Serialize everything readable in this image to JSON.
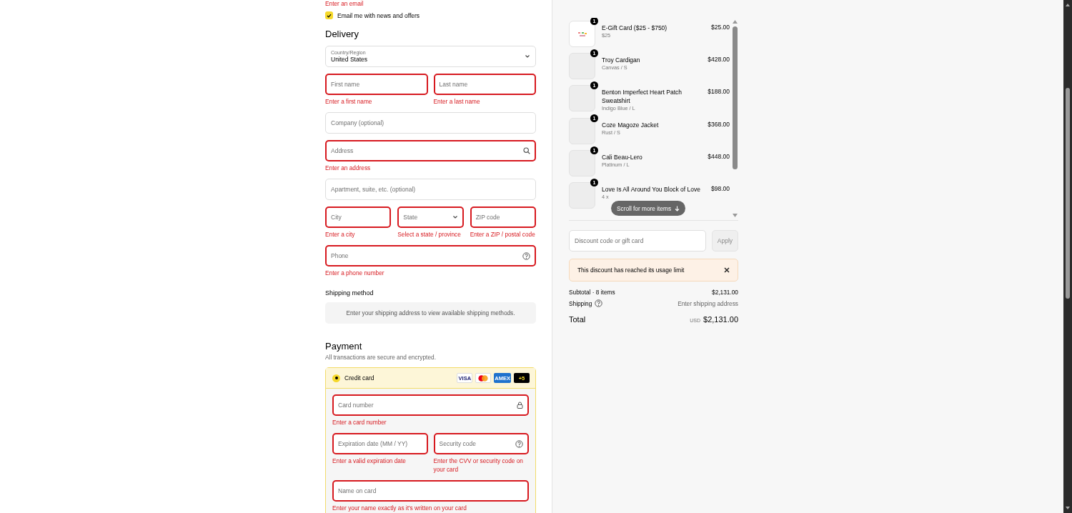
{
  "contact": {
    "email_error": "Enter an email",
    "newsletter": {
      "label": "Email me with news and offers",
      "checked": true
    }
  },
  "delivery": {
    "title": "Delivery",
    "rows": [
      [
        {
          "kind": "select",
          "label": "Country/Region",
          "value": "United States",
          "invalid": false
        }
      ],
      [
        {
          "kind": "text",
          "placeholder": "First name",
          "invalid": true,
          "error": "Enter a first name"
        },
        {
          "kind": "text",
          "placeholder": "Last name",
          "invalid": true,
          "error": "Enter a last name"
        }
      ],
      [
        {
          "kind": "text",
          "placeholder": "Company (optional)",
          "invalid": false
        }
      ],
      [
        {
          "kind": "search",
          "placeholder": "Address",
          "invalid": true,
          "error": "Enter an address"
        }
      ],
      [
        {
          "kind": "text",
          "placeholder": "Apartment, suite, etc. (optional)",
          "invalid": false
        }
      ],
      [
        {
          "kind": "text",
          "placeholder": "City",
          "invalid": true,
          "error": "Enter a city"
        },
        {
          "kind": "select",
          "placeholder": "State",
          "invalid": true,
          "error": "Select a state / province"
        },
        {
          "kind": "text",
          "placeholder": "ZIP code",
          "invalid": true,
          "error": "Enter a ZIP / postal code"
        }
      ],
      [
        {
          "kind": "help",
          "placeholder": "Phone",
          "invalid": true,
          "error": "Enter a phone number"
        }
      ]
    ]
  },
  "shipping_method": {
    "title": "Shipping method",
    "message": "Enter your shipping address to view available shipping methods."
  },
  "payment": {
    "title": "Payment",
    "subtitle": "All transactions are secure and encrypted.",
    "method": {
      "label": "Credit card",
      "selected": true,
      "brands": [
        {
          "kind": "visa",
          "label": "VISA"
        },
        {
          "kind": "mastercard"
        },
        {
          "kind": "amex",
          "label": "AMEX"
        },
        {
          "kind": "more",
          "label": "+5"
        }
      ]
    },
    "rows": [
      [
        {
          "kind": "lock",
          "placeholder": "Card number",
          "invalid": true,
          "error": "Enter a card number"
        }
      ],
      [
        {
          "kind": "text",
          "placeholder": "Expiration date (MM / YY)",
          "invalid": true,
          "error": "Enter a valid expiration date"
        },
        {
          "kind": "help",
          "placeholder": "Security code",
          "invalid": true,
          "error": "Enter the CVV or security code on your card"
        }
      ],
      [
        {
          "kind": "text",
          "placeholder": "Name on card",
          "invalid": true,
          "error": "Enter your name exactly as it's written on your card"
        }
      ]
    ]
  },
  "order": {
    "items": [
      {
        "kind": "gift",
        "quantity": "1",
        "name": "E-Gift Card ($25 - $750)",
        "variant": "$25",
        "price": "$25.00"
      },
      {
        "kind": "photo",
        "quantity": "1",
        "name": "Troy Cardigan",
        "variant": "Canvas / S",
        "price": "$428.00"
      },
      {
        "kind": "photo",
        "quantity": "1",
        "name": "Benton Imperfect Heart Patch Sweatshirt",
        "variant": "Indigo Blue / L",
        "price": "$188.00"
      },
      {
        "kind": "photo",
        "quantity": "1",
        "name": "Coze Magoze Jacket",
        "variant": "Rust / S",
        "price": "$368.00"
      },
      {
        "kind": "photo",
        "quantity": "1",
        "name": "Cali Beau-Lero",
        "variant": "Platinum / L",
        "price": "$448.00"
      },
      {
        "kind": "photo",
        "quantity": "1",
        "name": "Love Is All Around You Block of Love",
        "variant": "4 x",
        "price": "$98.00"
      }
    ],
    "scroll_hint": "Scroll for more items",
    "discount": {
      "placeholder": "Discount code or gift card",
      "button": "Apply",
      "disabled": true
    },
    "notice": "This discount has reached its usage limit",
    "subtotal_label": "Subtotal · 8 items",
    "subtotal": "$2,131.00",
    "shipping_label": "Shipping",
    "shipping_value": "Enter shipping address",
    "total_label": "Total",
    "currency": "USD",
    "total": "$2,131.00"
  }
}
